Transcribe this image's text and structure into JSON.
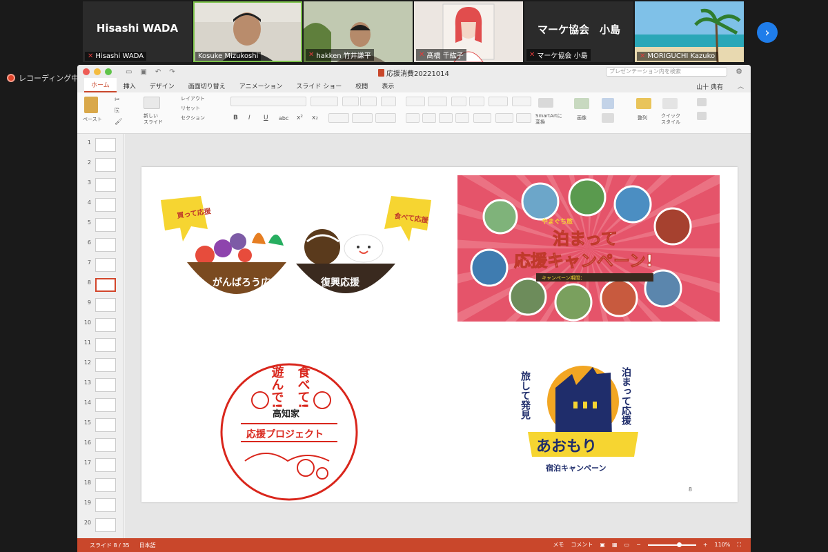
{
  "gallery": {
    "tiles": [
      {
        "label": "Hisashi WADA",
        "display_name": "Hisashi WADA"
      },
      {
        "label": "Kosuke Mizukoshi"
      },
      {
        "label": "hakken 竹井謙平"
      },
      {
        "label": "髙橋 千紘子"
      },
      {
        "label": "マーケ協会 小島",
        "display_name": "マーケ協会　小島"
      },
      {
        "label": "MORIGUCHI Kazuko"
      }
    ]
  },
  "recording": {
    "label": "レコーディング中"
  },
  "window": {
    "doc_title": "応援消費20221014",
    "search_placeholder": "プレゼンテーション内を検索",
    "user": "山十 典有",
    "tabs": [
      "ホーム",
      "挿入",
      "デザイン",
      "画面切り替え",
      "アニメーション",
      "スライド ショー",
      "校閲",
      "表示"
    ],
    "ribbon": {
      "paste": "ペースト",
      "new_slide": "新しい\nスライド",
      "layout": "レイアウト",
      "reset": "リセット",
      "section": "セクション",
      "smartart": "SmartArtに\n変換",
      "image": "画像",
      "arrange": "整列",
      "quick_style": "クイック\nスタイル"
    },
    "thumb_numbers": [
      "1",
      "2",
      "3",
      "4",
      "5",
      "6",
      "7",
      "8",
      "9",
      "10",
      "11",
      "12",
      "13",
      "14",
      "15",
      "16",
      "17",
      "18",
      "19",
      "20"
    ],
    "selected_slide": 8
  },
  "slide": {
    "number": "8",
    "hiroshima": {
      "bubble_left": "買って応援",
      "bubble_right": "食べて応援",
      "bowl_left": "がんばろう広島",
      "bowl_right": "復興応援"
    },
    "banner": {
      "top_text": "やまぐち旅",
      "main_line1": "泊まって",
      "main_line2": "応援キャンペーン!",
      "period_label": "キャンペーン期間："
    },
    "kochi": {
      "line_a": "遊んで!",
      "line_b": "食べて!",
      "family": "高知家",
      "project": "応援プロジェクト"
    },
    "aomori": {
      "left_text": "旅して発見",
      "right_text": "泊まって応援",
      "name": "あおもり",
      "campaign": "宿泊キャンペーン"
    }
  },
  "status": {
    "slide_info": "スライド 8 / 35",
    "language": "日本語",
    "notes": "メモ",
    "comments": "コメント",
    "zoom": "110%"
  }
}
